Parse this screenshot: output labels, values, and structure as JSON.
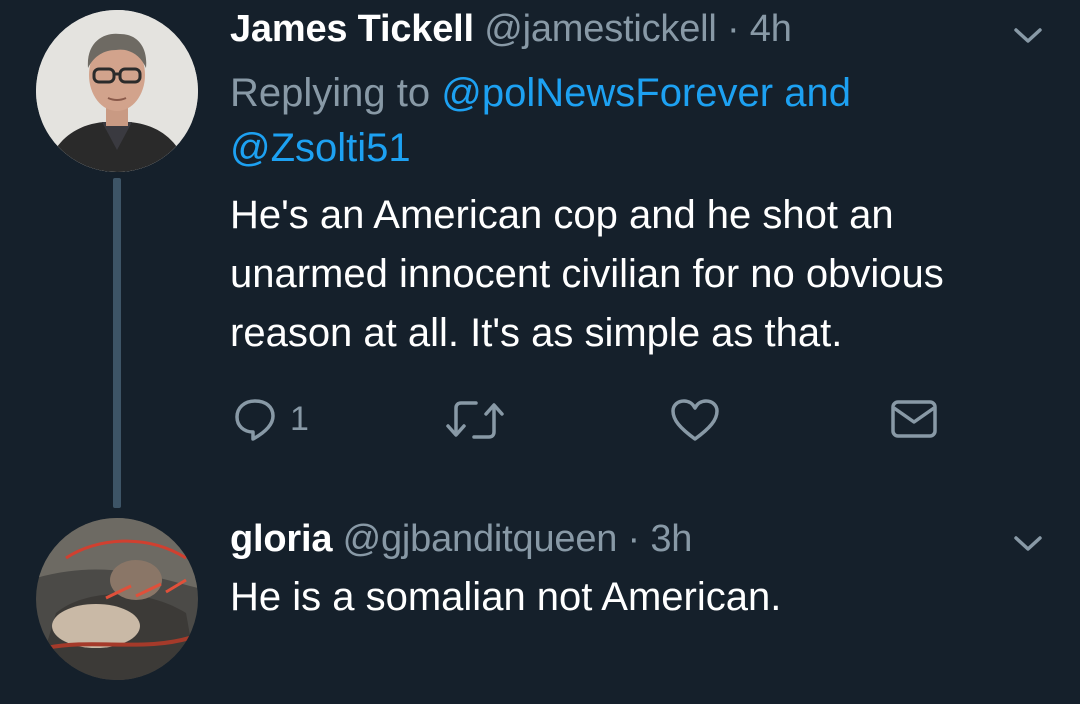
{
  "tweets": [
    {
      "name": "James Tickell",
      "handle": "@jamestickell",
      "separator": "·",
      "time": "4h",
      "replying_prefix": "Replying to",
      "replying_mention_1": "@polNewsForever",
      "replying_and": "and",
      "replying_mention_2": "@Zsolti51",
      "text": "He's an American cop and he shot an unarmed innocent civilian for no obvious reason at all. It's as simple as that.",
      "actions": {
        "reply_icon": "reply-icon",
        "reply_count": "1",
        "retweet_icon": "retweet-icon",
        "like_icon": "heart-icon",
        "dm_icon": "envelope-icon"
      }
    },
    {
      "name": "gloria",
      "handle": "@gjbanditqueen",
      "separator": "·",
      "time": "3h",
      "text": "He is a somalian not American."
    }
  ],
  "colors": {
    "background": "#15202b",
    "accent": "#1da1f2",
    "muted": "#8899a6",
    "thread_line": "#3d5466"
  }
}
